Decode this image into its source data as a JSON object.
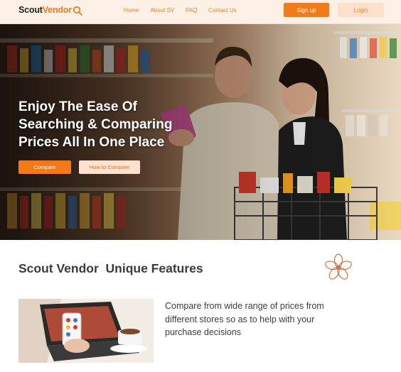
{
  "header": {
    "logo": {
      "part1": "Scout",
      "part2": "Vendor",
      "icon": "magnifier-icon"
    },
    "nav": [
      "Home",
      "About SV",
      "FAQ",
      "Contact Us"
    ],
    "signup_label": "Sign up",
    "login_label": "Login"
  },
  "hero": {
    "title": "Enjoy The Ease Of Searching & Comparing Prices All In One Place",
    "compare_label": "Compare",
    "how_label": "How to Compare"
  },
  "features": {
    "title": "Scout Vendor  Unique Features",
    "decoration_icon": "flower-outline-icon",
    "item1_text": "Compare from wide range of prices from different stores so as to help with your purchase decisions"
  },
  "colors": {
    "accent": "#f37a16",
    "accent_light": "#fde0cc",
    "header_bg": "#fdf1e7"
  }
}
